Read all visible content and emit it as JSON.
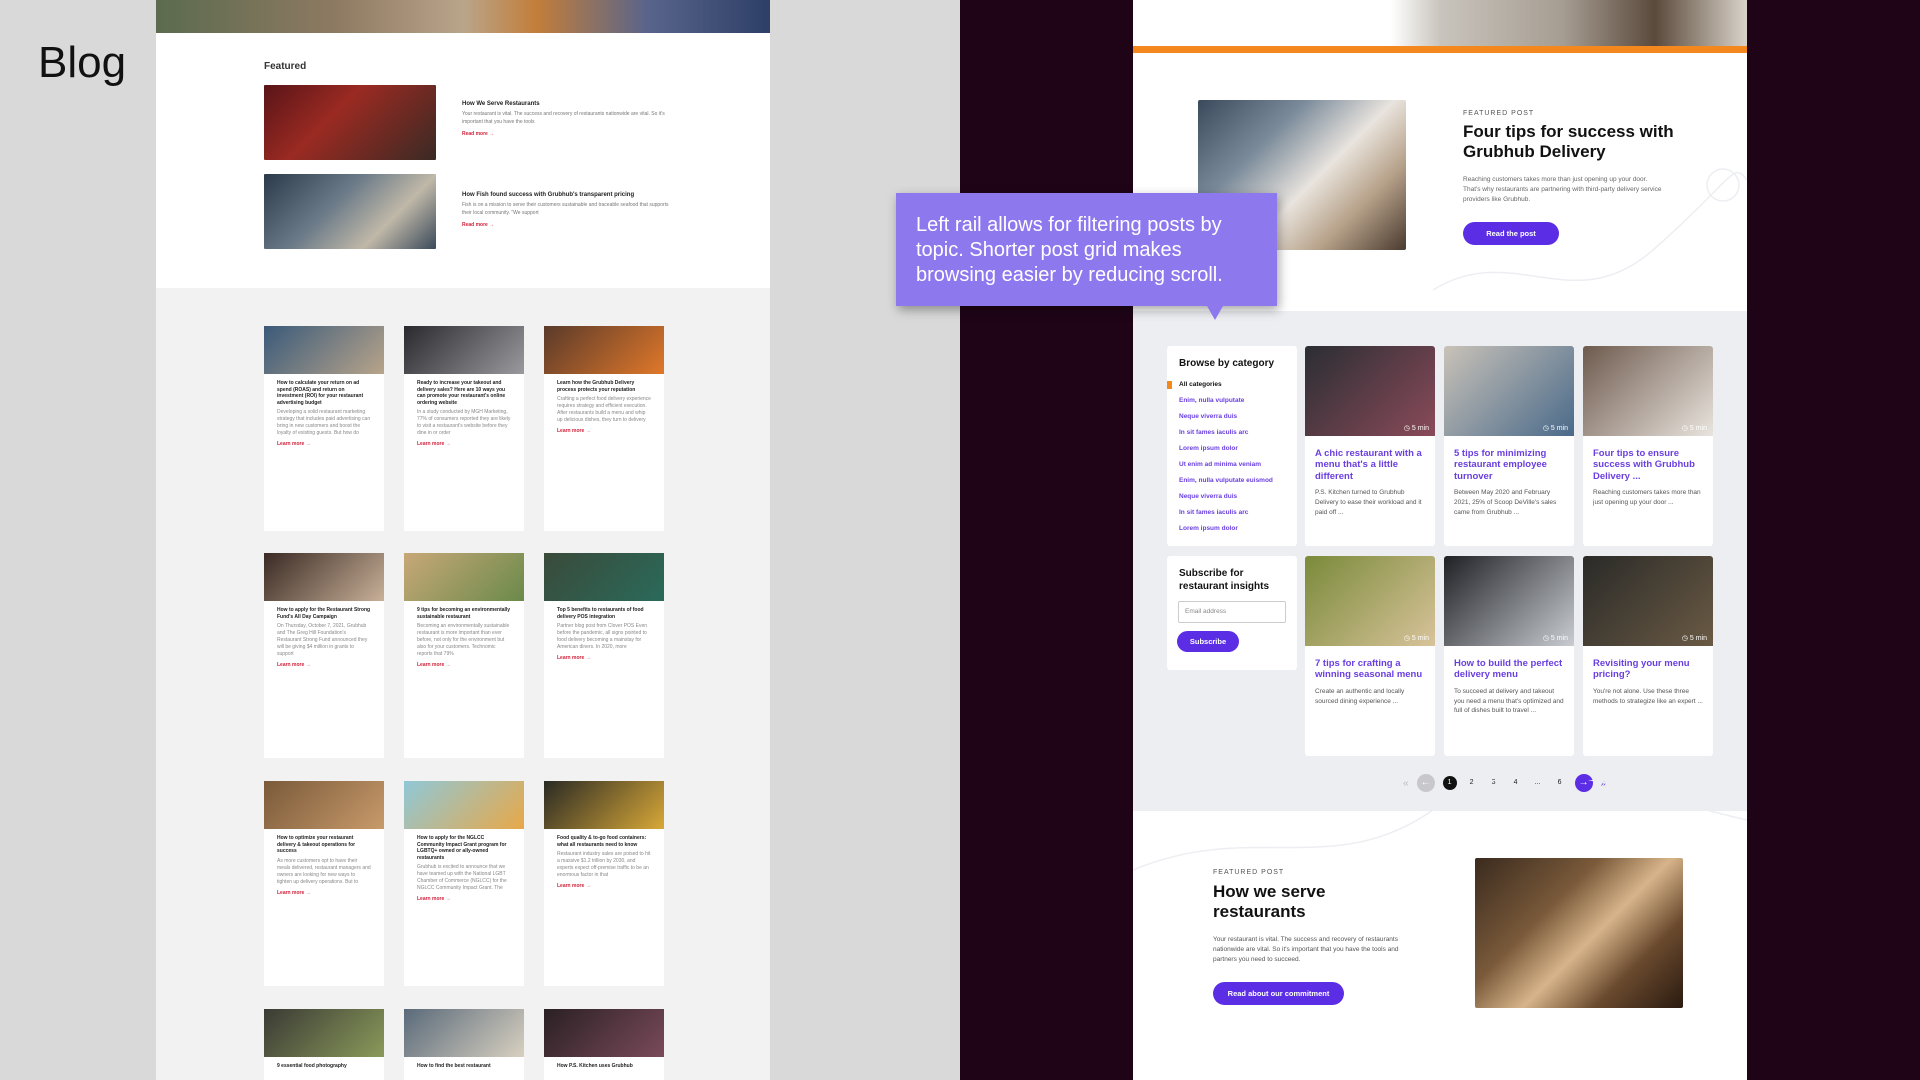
{
  "slide": {
    "title": "Blog"
  },
  "callout": {
    "text": "Left rail allows for filtering posts by topic. Shorter post grid makes browsing easier by reducing scroll."
  },
  "old_page": {
    "featured_label": "Featured",
    "featured": [
      {
        "title": "How We Serve Restaurants",
        "desc": "Your restaurant is vital. The success and recovery of restaurants nationwide are vital. So it's important that you have the tools",
        "link": "Read more →"
      },
      {
        "title": "How Fish found success with Grubhub's transparent pricing",
        "desc": "Fish is on a mission to serve their customers sustainable and traceable seafood that supports their local community. \"We support",
        "link": "Read more →"
      }
    ],
    "cards": [
      {
        "title": "How to calculate your return on ad spend (ROAS) and return on investment (ROI) for your restaurant advertising budget",
        "desc": "Developing a solid restaurant marketing strategy that includes paid advertising can bring in new customers and boost the loyalty of existing guests. But how do",
        "link": "Learn more →"
      },
      {
        "title": "Ready to increase your takeout and delivery sales? Here are 10 ways you can promote your restaurant's online ordering website",
        "desc": "In a study conducted by MGH Marketing, 77% of consumers reported they are likely to visit a restaurant's website before they dine in or order",
        "link": "Learn more →"
      },
      {
        "title": "Learn how the Grubhub Delivery process protects your reputation",
        "desc": "Crafting a perfect food delivery experience requires strategy and efficient execution. After restaurants build a menu and whip up delicious dishes, they turn to delivery",
        "link": "Learn more →"
      },
      {
        "title": "How to apply for the Restaurant Strong Fund's All Day Campaign",
        "desc": "On Thursday, October 7, 2021, Grubhub and The Greg Hill Foundation's Restaurant Strong Fund announced they will be giving $4 million in grants to support",
        "link": "Learn more →"
      },
      {
        "title": "9 tips for becoming an environmentally sustainable restaurant",
        "desc": "Becoming an environmentally sustainable restaurant is more important than ever before, not only for the environment but also for your customers. Technomic reports that 79%",
        "link": "Learn more →"
      },
      {
        "title": "Top 5 benefits to restaurants of food delivery POS integration",
        "desc": "Partner blog post from Clover POS Even before the pandemic, all signs pointed to food delivery becoming a mainstay for American diners. In 2020, more",
        "link": "Learn more →"
      },
      {
        "title": "How to optimize your restaurant delivery & takeout operations for success",
        "desc": "As more customers opt to have their meals delivered, restaurant managers and owners are looking for new ways to tighten up delivery operations. But to",
        "link": "Learn more →"
      },
      {
        "title": "How to apply for the NGLCC Community Impact Grant program for LGBTQ+ owned or ally-owned restaurants",
        "desc": "Grubhub is excited to announce that we have teamed up with the National LGBT Chamber of Commerce (NGLCC) for the NGLCC Community Impact Grant. The",
        "link": "Learn more →"
      },
      {
        "title": "Food quality & to-go food containers: what all restaurants need to know",
        "desc": "Restaurant industry sales are poised to hit a massive $1.2 trillion by 2030, and experts expect off-premise traffic to be an enormous factor in that",
        "link": "Learn more →"
      },
      {
        "title": "9 essential food photography",
        "desc": "",
        "link": ""
      },
      {
        "title": "How to find the best restaurant",
        "desc": "",
        "link": ""
      },
      {
        "title": "How P.S. Kitchen uses Grubhub",
        "desc": "",
        "link": ""
      }
    ]
  },
  "new_page": {
    "featured_top": {
      "kicker": "FEATURED POST",
      "title": "Four tips for success with Grubhub Delivery",
      "desc": "Reaching customers takes more than just opening up your door. That's why restaurants are partnering with third-party delivery service providers like Grubhub.",
      "button": "Read the post"
    },
    "rail": {
      "heading": "Browse by category",
      "items": [
        "All categories",
        "Enim, nulla vulputate",
        "Neque viverra duis",
        "In sit fames iaculis arc",
        "Lorem ipsum dolor",
        "Ut enim ad minima veniam",
        "Enim, nulla vulputate euismod",
        "Neque viverra duis",
        "In sit fames iaculis arc",
        "Lorem ipsum dolor"
      ]
    },
    "subscribe": {
      "heading": "Subscribe for restaurant insights",
      "placeholder": "Email address",
      "button": "Subscribe"
    },
    "cards": [
      {
        "time": "5 min",
        "title": "A chic restaurant with a menu that's a little different",
        "desc": "P.S. Kitchen turned to Grubhub Delivery to ease their workload and it paid off ...",
        "img1": "#2b2e33",
        "img2": "#8a4a5a"
      },
      {
        "time": "5 min",
        "title": "5 tips for minimizing restaurant employee turnover",
        "desc": "Between May 2020 and February 2021, 25% of Scoop DeVille's sales came from Grubhub ...",
        "img1": "#c9c2b8",
        "img2": "#4a6a8a"
      },
      {
        "time": "5 min",
        "title": "Four tips to ensure success with Grubhub Delivery ...",
        "desc": "Reaching customers takes more than just opening up your door ...",
        "img1": "#6e5a4e",
        "img2": "#e9e4de"
      },
      {
        "time": "5 min",
        "title": "7 tips for crafting a winning seasonal menu",
        "desc": "Create an authentic and locally sourced dining experience ...",
        "img1": "#7a8a3a",
        "img2": "#d8c39a"
      },
      {
        "time": "5 min",
        "title": "How to build the perfect delivery menu",
        "desc": "To succeed at delivery and takeout you need a menu that's optimized and full of dishes built to travel ...",
        "img1": "#1e2024",
        "img2": "#c9ccd1"
      },
      {
        "time": "5 min",
        "title": "Revisiting your menu pricing?",
        "desc": "You're not alone. Use these three methods to strategize like an expert ...",
        "img1": "#2a2a28",
        "img2": "#6a5a44"
      }
    ],
    "pagination": {
      "first": "«",
      "prev": "←",
      "pages": [
        "1",
        "2",
        "3",
        "4",
        "...",
        "6"
      ],
      "next": "→",
      "last": "»"
    },
    "featured_bottom": {
      "kicker": "FEATURED POST",
      "title": "How we serve restaurants",
      "desc": "Your restaurant is vital. The success and recovery of restaurants nationwide are vital. So it's important that you have the tools and partners you need to succeed.",
      "button": "Read about our commitment"
    }
  }
}
